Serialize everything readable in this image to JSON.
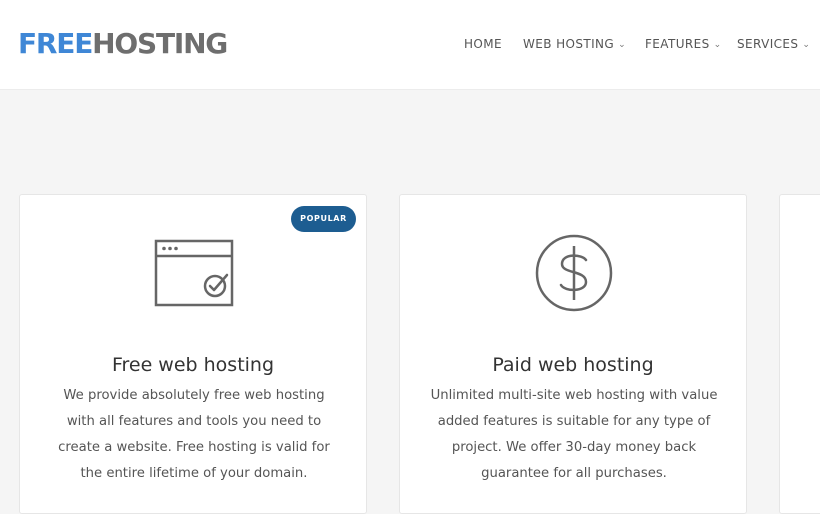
{
  "logo": {
    "part1": "FREE",
    "part2": "HOSTING"
  },
  "nav": [
    {
      "label": "HOME",
      "has_dropdown": false
    },
    {
      "label": "WEB HOSTING",
      "has_dropdown": true
    },
    {
      "label": "FEATURES",
      "has_dropdown": true
    },
    {
      "label": "SERVICES",
      "has_dropdown": true
    }
  ],
  "cards": [
    {
      "badge": "POPULAR",
      "icon": "browser-window-check-icon",
      "title": "Free web hosting",
      "description": "We provide absolutely free web hosting with all features and tools you need to create a website. Free hosting is valid for the entire lifetime of your domain."
    },
    {
      "icon": "dollar-circle-icon",
      "title": "Paid web hosting",
      "description": "Unlimited multi-site web hosting with value added features is suitable for any type of project. We offer 30-day money back guarantee for all purchases."
    }
  ],
  "colors": {
    "brand_blue": "#3f87d6",
    "logo_gray": "#6e6e6e",
    "badge_bg": "#1d5d91",
    "icon_gray": "#666666"
  }
}
